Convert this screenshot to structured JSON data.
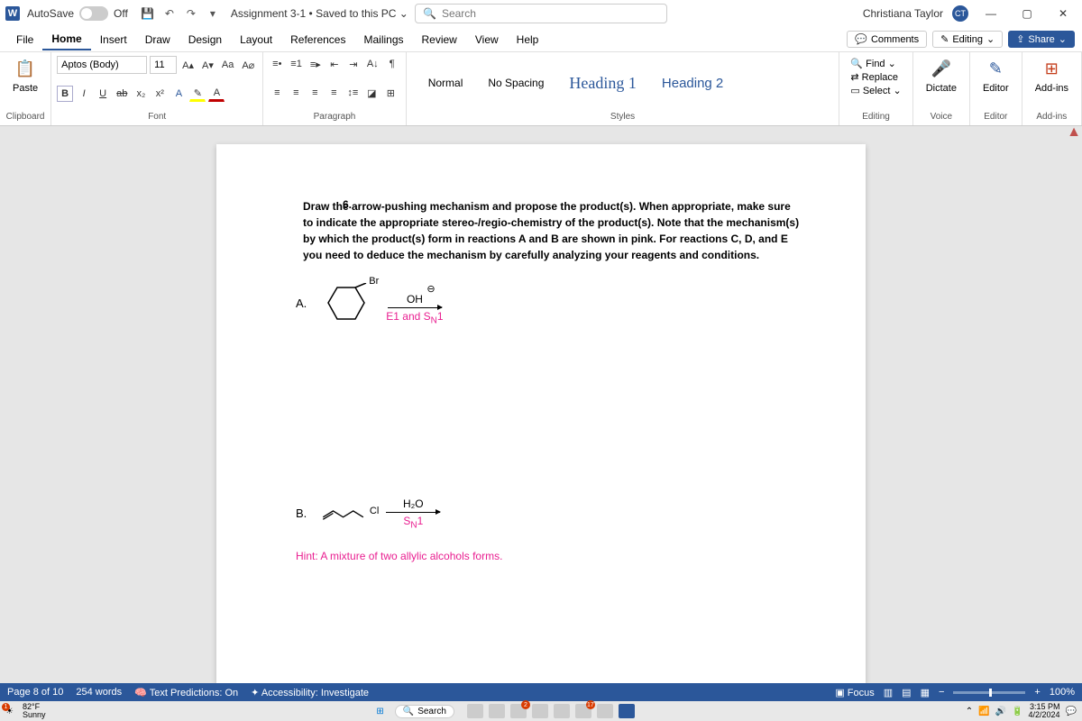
{
  "title_bar": {
    "autosave_label": "AutoSave",
    "autosave_state": "Off",
    "doc_title": "Assignment 3-1 • Saved to this PC ⌄",
    "search_placeholder": "Search",
    "user_name": "Christiana Taylor",
    "user_initials": "CT"
  },
  "menu": {
    "items": [
      "File",
      "Home",
      "Insert",
      "Draw",
      "Design",
      "Layout",
      "References",
      "Mailings",
      "Review",
      "View",
      "Help"
    ],
    "active": 1,
    "comments": "Comments",
    "editing": "Editing",
    "share": "Share"
  },
  "ribbon": {
    "clipboard": {
      "paste": "Paste",
      "label": "Clipboard"
    },
    "font": {
      "name": "Aptos (Body)",
      "size": "11",
      "label": "Font",
      "aa": "Aa"
    },
    "paragraph": {
      "label": "Paragraph"
    },
    "styles": {
      "items": [
        "Normal",
        "No Spacing",
        "Heading 1",
        "Heading 2"
      ],
      "label": "Styles"
    },
    "editing": {
      "find": "Find",
      "replace": "Replace",
      "select": "Select",
      "label": "Editing"
    },
    "voice": {
      "dictate": "Dictate",
      "label": "Voice"
    },
    "editor": {
      "editor": "Editor",
      "label": "Editor"
    },
    "addins": {
      "addins": "Add-ins",
      "label": "Add-ins"
    }
  },
  "document": {
    "q_number": "6.",
    "q_text": "Draw the arrow-pushing mechanism and propose the product(s). When appropriate, make sure to indicate the appropriate stereo-/regio-chemistry of the product(s). Note that the mechanism(s) by which the product(s) form in reactions A and B are shown in pink. For reactions C, D, and E you need to deduce the mechanism by carefully analyzing your reagents and conditions.",
    "reactionA": {
      "label": "A.",
      "substrate_label": "Br",
      "reagent_top": "OH",
      "reagent_bottom": "E1 and SN1"
    },
    "reactionB": {
      "label": "B.",
      "substrate_label": "Cl",
      "reagent_top": "H₂O",
      "reagent_bottom": "SN1",
      "hint": "Hint: A mixture of two allylic alcohols forms."
    }
  },
  "status": {
    "page": "Page 8 of 10",
    "words": "254 words",
    "predictions": "Text Predictions: On",
    "accessibility": "Accessibility: Investigate",
    "focus": "Focus",
    "zoom": "100%"
  },
  "taskbar": {
    "weather_temp": "82°F",
    "weather_desc": "Sunny",
    "search": "Search",
    "time": "3:15 PM",
    "date": "4/2/2024",
    "badge1": "1",
    "badge2": "2",
    "badge3": "17"
  }
}
